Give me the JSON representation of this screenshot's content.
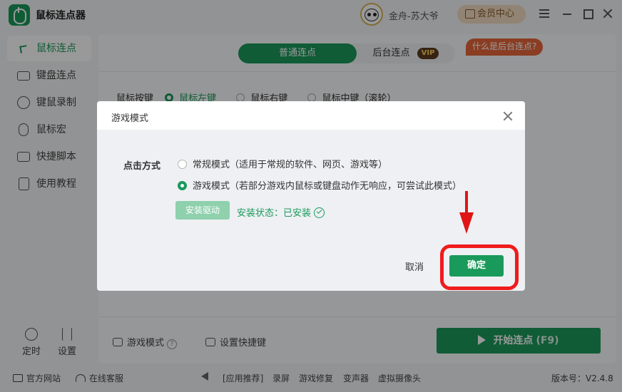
{
  "app": {
    "title": "鼠标连点器",
    "username": "金舟-苏大爷",
    "vip_center": "会员中心"
  },
  "sidebar": {
    "items": [
      {
        "label": "鼠标连点",
        "icon": "mouse-click-icon"
      },
      {
        "label": "键盘连点",
        "icon": "keyboard-icon"
      },
      {
        "label": "键鼠录制",
        "icon": "record-icon"
      },
      {
        "label": "鼠标宏",
        "icon": "mouse-icon"
      },
      {
        "label": "快捷脚本",
        "icon": "script-icon"
      },
      {
        "label": "使用教程",
        "icon": "tutorial-icon"
      }
    ],
    "timer": "定时",
    "settings": "设置"
  },
  "main": {
    "tab_normal": "普通连点",
    "tab_background": "后台连点",
    "vip_tag": "VIP",
    "bg_help": "什么是后台连点?",
    "button_label": "鼠标按键",
    "button_options": [
      "鼠标左键",
      "鼠标右键",
      "鼠标中键（滚轮）"
    ],
    "game_mode": "游戏模式",
    "set_hotkey": "设置快捷键",
    "start": "开始连点",
    "start_key": "(F9)"
  },
  "statusbar": {
    "website": "官方网站",
    "support": "在线客服",
    "recommend": "[应用推荐]",
    "links": [
      "录屏",
      "游戏修复",
      "变声器",
      "虚拟摄像头"
    ],
    "version": "版本号：V2.4.8"
  },
  "dialog": {
    "title": "游戏模式",
    "click_method": "点击方式",
    "option_normal": "常规模式（适用于常规的软件、网页、游戏等）",
    "option_game": "游戏模式（若部分游戏内鼠标或键盘动作无响应，可尝试此模式）",
    "install_driver": "安装驱动",
    "install_status": "安装状态：已安装",
    "cancel": "取消",
    "confirm": "确定"
  },
  "colors": {
    "accent": "#1a9a5a",
    "highlight": "#ef1c1c"
  }
}
